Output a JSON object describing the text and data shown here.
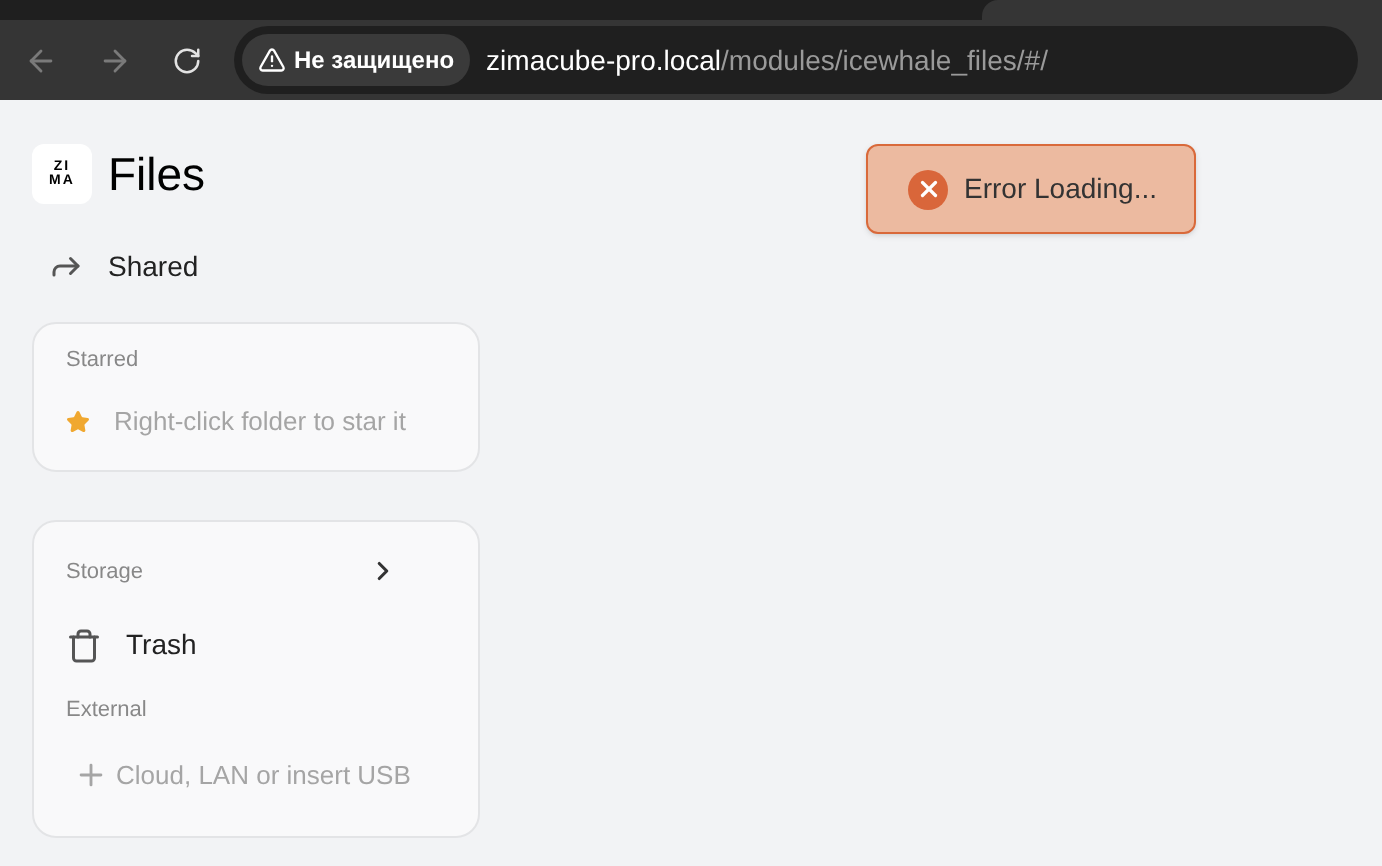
{
  "browser": {
    "security_label": "Не защищено",
    "url_host": "zimacube-pro.local",
    "url_path": "/modules/icewhale_files/#/"
  },
  "app": {
    "logo_lines": [
      "ZI",
      "MA"
    ],
    "title": "Files"
  },
  "sidebar": {
    "shared": "Shared",
    "starred": {
      "heading": "Starred",
      "hint": "Right-click folder to star it"
    },
    "storage": {
      "heading": "Storage",
      "trash": "Trash",
      "external_heading": "External",
      "external_hint": "Cloud, LAN or insert USB"
    }
  },
  "toast": {
    "kind": "error",
    "message": "Error Loading..."
  }
}
